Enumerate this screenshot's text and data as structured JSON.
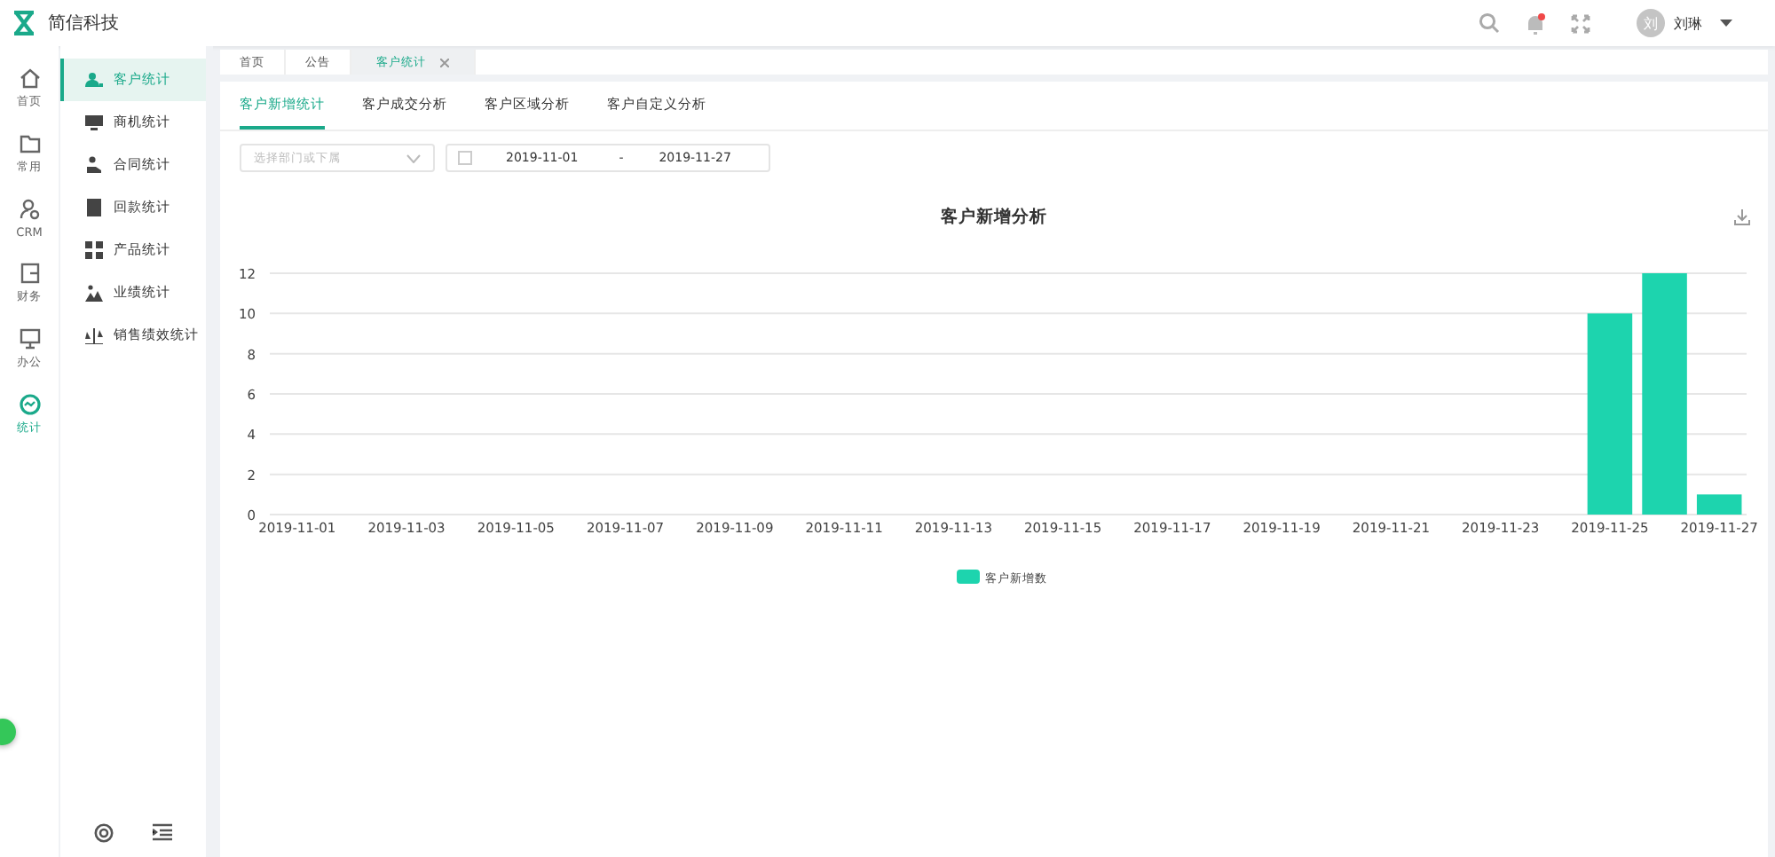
{
  "header": {
    "brand": "简信科技",
    "avatar_text": "刘",
    "user_name": "刘琳"
  },
  "rail": [
    {
      "label": "首页",
      "selected": false
    },
    {
      "label": "常用",
      "selected": false
    },
    {
      "label": "CRM",
      "selected": false
    },
    {
      "label": "财务",
      "selected": false
    },
    {
      "label": "办公",
      "selected": false
    },
    {
      "label": "统计",
      "selected": true
    }
  ],
  "submenu": [
    {
      "label": "客户统计",
      "selected": true
    },
    {
      "label": "商机统计",
      "selected": false
    },
    {
      "label": "合同统计",
      "selected": false
    },
    {
      "label": "回款统计",
      "selected": false
    },
    {
      "label": "产品统计",
      "selected": false
    },
    {
      "label": "业绩统计",
      "selected": false
    },
    {
      "label": "销售绩效统计",
      "selected": false
    }
  ],
  "page_tabs": [
    {
      "label": "首页",
      "closable": false,
      "selected": false
    },
    {
      "label": "公告",
      "closable": false,
      "selected": false
    },
    {
      "label": "客户统计",
      "closable": true,
      "selected": true
    }
  ],
  "sub_tabs": [
    {
      "label": "客户新增统计",
      "selected": true
    },
    {
      "label": "客户成交分析",
      "selected": false
    },
    {
      "label": "客户区域分析",
      "selected": false
    },
    {
      "label": "客户自定义分析",
      "selected": false
    }
  ],
  "filter": {
    "placeholder": "选择部门或下属",
    "date_start": "2019-11-01",
    "date_separator": "-",
    "date_end": "2019-11-27"
  },
  "chart_data": {
    "type": "bar",
    "title": "客户新增分析",
    "categories": [
      "2019-11-01",
      null,
      "2019-11-03",
      null,
      "2019-11-05",
      null,
      "2019-11-07",
      null,
      "2019-11-09",
      null,
      "2019-11-11",
      null,
      "2019-11-13",
      null,
      "2019-11-15",
      null,
      "2019-11-17",
      null,
      "2019-11-19",
      null,
      "2019-11-21",
      null,
      "2019-11-23",
      null,
      "2019-11-25",
      null,
      "2019-11-27"
    ],
    "series": [
      {
        "name": "客户新增数",
        "color": "#1dd4ae",
        "values": [
          0,
          0,
          0,
          0,
          0,
          0,
          0,
          0,
          0,
          0,
          0,
          0,
          0,
          0,
          0,
          0,
          0,
          0,
          0,
          0,
          0,
          0,
          0,
          0,
          10,
          12,
          1
        ]
      }
    ],
    "ylim": [
      0,
      12
    ],
    "yticks": [
      0,
      2,
      4,
      6,
      8,
      10,
      12
    ],
    "grid": true
  }
}
